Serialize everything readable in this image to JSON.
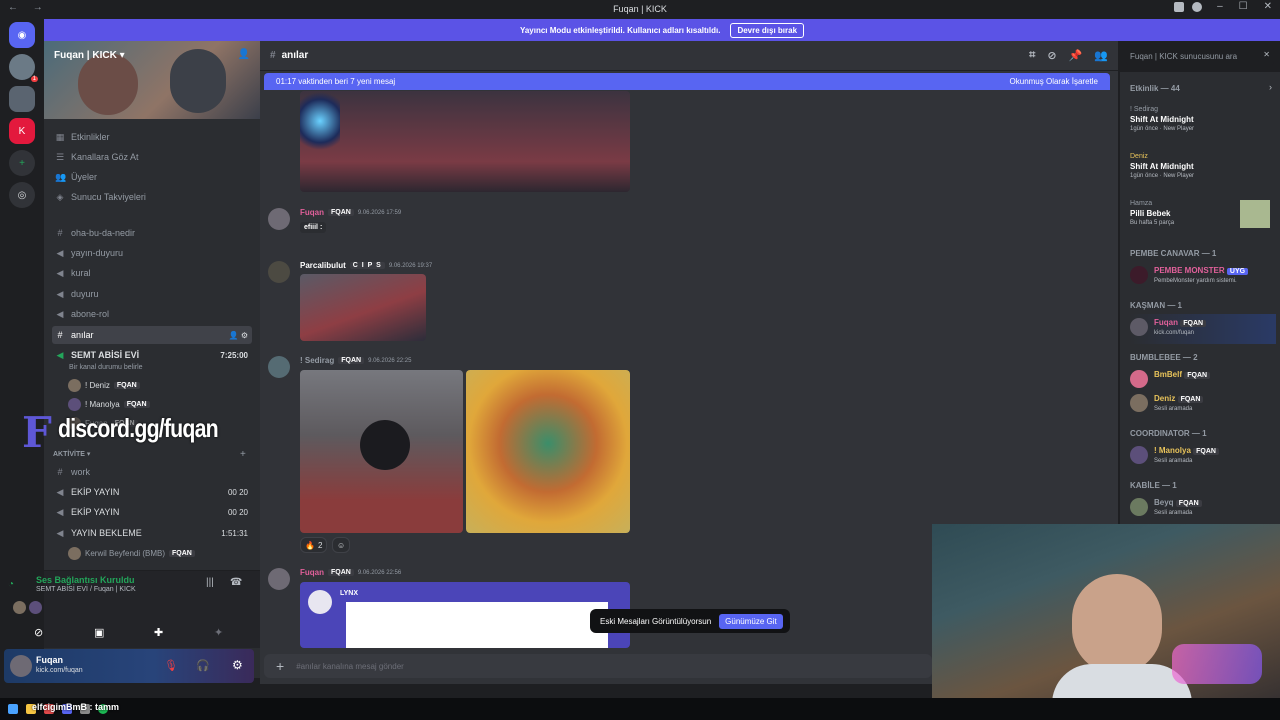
{
  "window": {
    "title": "Fuqan | KICK"
  },
  "banner": {
    "text": "Yayıncı Modu etkinleştirildi. Kullanıcı adları kısaltıldı.",
    "button": "Devre dışı bırak"
  },
  "server": {
    "name": "Fuqan | KICK",
    "badge_count": "1"
  },
  "sidebar": {
    "top_items": [
      {
        "label": "Etkinlikler",
        "icon": "calendar-icon"
      },
      {
        "label": "Kanallara Göz At",
        "icon": "browse-icon"
      },
      {
        "label": "Üyeler",
        "icon": "members-icon"
      },
      {
        "label": "Sunucu Takviyeleri",
        "icon": "boost-icon"
      }
    ],
    "channels": [
      {
        "label": "oha-bu-da-nedir",
        "type": "text"
      },
      {
        "label": "yayın-duyuru",
        "type": "announce"
      },
      {
        "label": "kural",
        "type": "announce"
      },
      {
        "label": "duyuru",
        "type": "announce"
      },
      {
        "label": "abone-rol",
        "type": "announce"
      },
      {
        "label": "anılar",
        "type": "text",
        "active": true
      }
    ],
    "voice_main": {
      "label": "SEMT ABİSİ EVİ",
      "timer": "7:25:00",
      "status": "Bir kanal durumu belirle",
      "users": [
        {
          "name": "! Deniz",
          "tag": "FQAN"
        },
        {
          "name": "! Manolya",
          "tag": "FQAN"
        },
        {
          "name": "Fuqan",
          "tag": "FQAN"
        }
      ]
    },
    "category": "AKTİVİTE",
    "activity_channels": [
      {
        "label": "work",
        "type": "text",
        "right": ""
      },
      {
        "label": "EKİP YAYIN",
        "type": "voice",
        "right": "00  20"
      },
      {
        "label": "EKİP YAYIN",
        "type": "voice",
        "right": "00  20"
      },
      {
        "label": "YAYIN BEKLEME",
        "type": "voice",
        "right": "1:51:31"
      }
    ],
    "waiting_user": {
      "name": "Kerwil Beyfendi (BMB)",
      "tag": "FQAN"
    }
  },
  "overlay": {
    "link": "discord.gg/fuqan",
    "letter": "F"
  },
  "voice_panel": {
    "status": "Ses Bağlantısı Kuruldu",
    "location": "SEMT ABİSİ EVİ / Fuqan | KICK"
  },
  "user_panel": {
    "name": "Fuqan",
    "sub": "kick.com/fuqan"
  },
  "channel": {
    "name": "anılar",
    "new_messages": "01:17 vaktinden beri 7 yeni mesaj",
    "mark_read": "Okunmuş Olarak İşaretle"
  },
  "messages": [
    {
      "author": "Fuqan",
      "tag": "FQAN",
      "time": "9.06.2026 17:59",
      "content": "efiiil :",
      "color": "#e0609a"
    },
    {
      "author": "Parcalibulut",
      "tag": "C I P S",
      "time": "9.06.2026 19:37",
      "color": "#ffffff"
    },
    {
      "author": "! Sedirag",
      "tag": "FQAN",
      "time": "9.06.2026 22:25",
      "color": "#949ba4",
      "reaction_count": "2"
    },
    {
      "author": "Fuqan",
      "tag": "FQAN",
      "time": "9.06.2026 22:56",
      "color": "#e0609a",
      "embed_title": "LYNX"
    }
  ],
  "toast": {
    "text": "Eski Mesajları Görüntülüyorsun",
    "button": "Günümüze Git"
  },
  "composer": {
    "placeholder": "#anılar kanalına mesaj gönder"
  },
  "search": {
    "placeholder": "Fuqan | KICK sunucusunu ara"
  },
  "members": {
    "activity_header": "Etkinlik — 44",
    "activities": [
      {
        "name": "! Sedirag",
        "title": "Shift At Midnight",
        "sub1": "1gün önce",
        "sub2": "New Player"
      },
      {
        "name": "Deniz",
        "title": "Shift At Midnight",
        "sub1": "1gün önce",
        "sub2": "New Player"
      },
      {
        "name": "Hamza",
        "title": "Pilli Bebek",
        "sub1": "Bu hafta 5 parça",
        "sub2": ""
      }
    ],
    "groups": [
      {
        "header": "PEMBE CANAVAR — 1",
        "members": [
          {
            "name": "PEMBE MONSTER",
            "badge": "UYG",
            "sub": "PembeMonster yardım sistemi.",
            "color": "#e0609a"
          }
        ]
      },
      {
        "header": "KAŞMAN — 1",
        "members": [
          {
            "name": "Fuqan",
            "badge": "FQAN",
            "sub": "kick.com/fuqan",
            "color": "#e0609a"
          }
        ]
      },
      {
        "header": "BUMBLEBEE — 2",
        "members": [
          {
            "name": "BmBelf",
            "badge": "FQAN",
            "sub": "",
            "color": "#e8c35a"
          },
          {
            "name": "Deniz",
            "badge": "FQAN",
            "sub": "Sesli aramada",
            "color": "#e8c35a"
          }
        ]
      },
      {
        "header": "COORDINATOR — 1",
        "members": [
          {
            "name": "! Manolya",
            "badge": "FQAN",
            "sub": "Sesli aramada",
            "color": "#e8c35a"
          }
        ]
      },
      {
        "header": "KABİLE — 1",
        "members": [
          {
            "name": "Beyq",
            "badge": "FQAN",
            "sub": "Sesli aramada",
            "color": "#949ba4"
          }
        ]
      }
    ]
  },
  "taskbar": {
    "text": "elfcigimBmB : tamm"
  },
  "colors": {
    "accent": "#5865f2",
    "banner": "#5b53e6",
    "sidebar": "#2b2d31",
    "main": "#313338"
  }
}
